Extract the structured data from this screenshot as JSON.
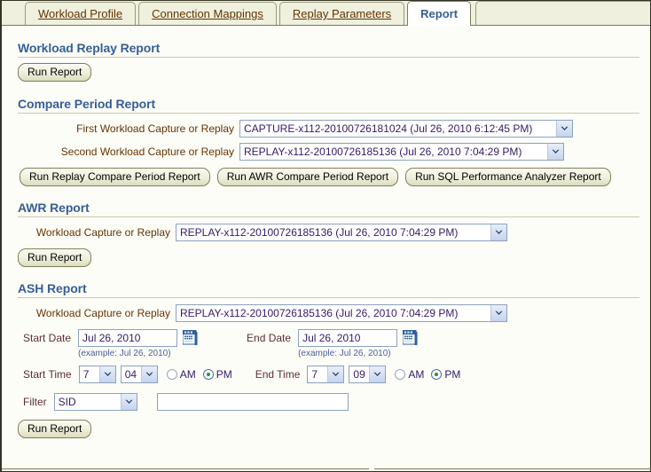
{
  "tabs": [
    {
      "label": "Workload Profile",
      "active": false
    },
    {
      "label": "Connection Mappings",
      "active": false
    },
    {
      "label": "Replay Parameters",
      "active": false
    },
    {
      "label": "Report",
      "active": true
    }
  ],
  "sections": {
    "workload_replay": {
      "title": "Workload Replay Report",
      "run_button": "Run Report"
    },
    "compare_period": {
      "title": "Compare Period Report",
      "first_label": "First Workload Capture or Replay",
      "first_value": "CAPTURE-x112-20100726181024 (Jul 26, 2010 6:12:45 PM)",
      "second_label": "Second Workload Capture or Replay",
      "second_value": "REPLAY-x112-20100726185136 (Jul 26, 2010 7:04:29 PM)",
      "buttons": [
        "Run Replay Compare Period Report",
        "Run AWR Compare Period Report",
        "Run SQL Performance Analyzer Report"
      ]
    },
    "awr": {
      "title": "AWR Report",
      "capture_label": "Workload Capture or Replay",
      "capture_value": "REPLAY-x112-20100726185136 (Jul 26, 2010 7:04:29 PM)",
      "run_button": "Run Report"
    },
    "ash": {
      "title": "ASH Report",
      "capture_label": "Workload Capture or Replay",
      "capture_value": "REPLAY-x112-20100726185136 (Jul 26, 2010 7:04:29 PM)",
      "start_date_label": "Start Date",
      "start_date_value": "Jul 26, 2010",
      "start_date_hint": "(example: Jul 26, 2010)",
      "end_date_label": "End Date",
      "end_date_value": "Jul 26, 2010",
      "end_date_hint": "(example: Jul 26, 2010)",
      "start_time_label": "Start Time",
      "start_time_hour": "7",
      "start_time_minute": "04",
      "start_time_am": "AM",
      "start_time_pm": "PM",
      "start_time_meridiem_selected": "PM",
      "end_time_label": "End Time",
      "end_time_hour": "7",
      "end_time_minute": "09",
      "end_time_am": "AM",
      "end_time_pm": "PM",
      "end_time_meridiem_selected": "PM",
      "filter_label": "Filter",
      "filter_value": "SID",
      "filter_text_value": "",
      "filter_text_placeholder": "",
      "run_button": "Run Report"
    }
  },
  "icons": {
    "calendar": "calendar-icon",
    "chevron_down": "chevron-down-icon"
  },
  "colors": {
    "header_blue": "#365e96",
    "label_brown": "#663300",
    "tab_bar_bg": "#eff0de",
    "page_bg": "#fdfdf8",
    "select_text": "#331a66",
    "radio_selected_dot": "#1f9b1f"
  }
}
